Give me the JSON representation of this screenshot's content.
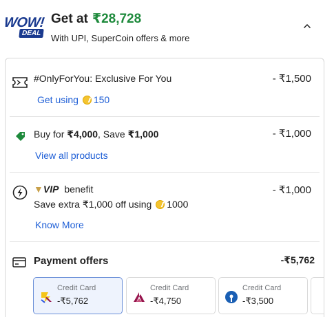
{
  "deal": {
    "badge_line1": "WOW!",
    "badge_line2": "DEAL",
    "get_at_label": "Get at",
    "price": "₹28,728",
    "subtitle": "With UPI, SuperCoin offers & more"
  },
  "offers": [
    {
      "icon": "ticket-icon",
      "title": "#OnlyForYou: Exclusive For You",
      "amount": "- ₹1,500",
      "link_label": "Get using",
      "link_coins": "150"
    },
    {
      "icon": "tag-icon",
      "title_prefix": "Buy for ",
      "title_bold1": "₹4,000",
      "title_mid": ", Save ",
      "title_bold2": "₹1,000",
      "amount": "- ₹1,000",
      "link_label": "View all products"
    },
    {
      "icon": "lightning-icon",
      "vip_label": "VIP",
      "benefit_label": "benefit",
      "detail_prefix": "Save extra ₹1,000 off using",
      "detail_coins": "1000",
      "amount": "- ₹1,000",
      "link_label": "Know More"
    }
  ],
  "payment": {
    "title": "Payment offers",
    "amount": "-₹5,762",
    "cards": [
      {
        "type": "Credit Card",
        "value": "-₹5,762",
        "selected": true,
        "logo": "flipkart-axis-logo"
      },
      {
        "type": "Credit Card",
        "value": "-₹4,750",
        "selected": false,
        "logo": "axis-bank-logo"
      },
      {
        "type": "Credit Card",
        "value": "-₹3,500",
        "selected": false,
        "logo": "sbi-logo"
      }
    ]
  },
  "colors": {
    "price_green": "#1e8a3c",
    "link_blue": "#1f5fd6",
    "badge_blue": "#1a3a8f"
  }
}
